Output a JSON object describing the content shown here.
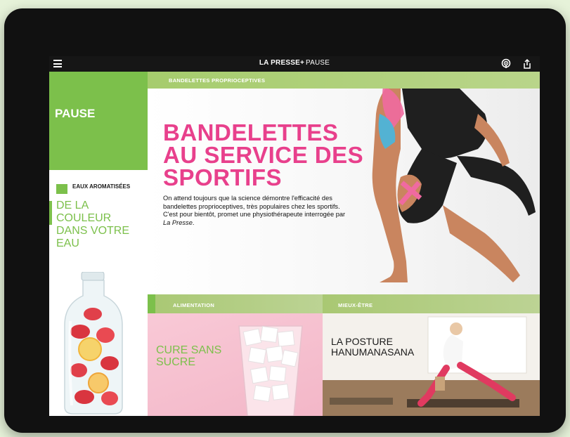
{
  "topbar": {
    "brand_bold": "LA PRESSE",
    "brand_plus": "+",
    "brand_section": "PAUSE"
  },
  "left": {
    "section_title": "PAUSE",
    "side_story": {
      "category": "EAUX AROMATISÉES",
      "title": "DE LA COULEUR DANS VOTRE EAU"
    }
  },
  "main": {
    "category": "BANDELETTES PROPRIOCEPTIVES",
    "headline": "BANDELETTES AU SERVICE DES SPORTIFS",
    "body": "On attend toujours que la science démontre l'efficacité des bandelettes proprioceptives, très populaires chez les sportifs. C'est pour bientôt, promet une physiothérapeute interrogée par ",
    "body_source": "La Presse",
    "body_end": "."
  },
  "cards": [
    {
      "category": "ALIMENTATION",
      "title": "CURE SANS SUCRE"
    },
    {
      "category": "MIEUX-ÊTRE",
      "title": "LA POSTURE HANUMANASANA"
    }
  ],
  "colors": {
    "accent_green": "#7cc04b",
    "headline_pink": "#e8408c",
    "bar_green": "#a6cc6d",
    "frame": "#111111",
    "background": "#e6f2d9"
  },
  "icons": [
    "menu-icon",
    "podcast-icon",
    "share-icon"
  ]
}
